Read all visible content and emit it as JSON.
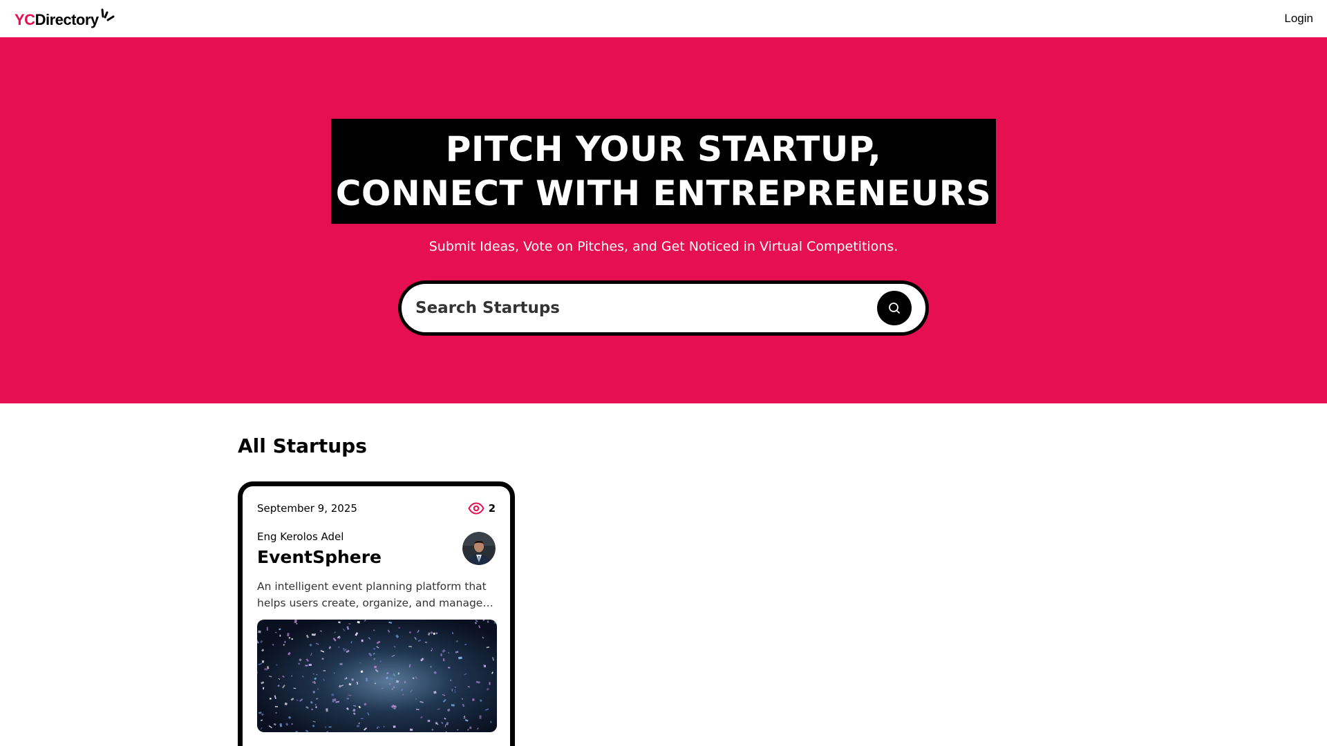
{
  "colors": {
    "brand_pink": "#e60f51",
    "black": "#000000",
    "white": "#ffffff"
  },
  "navbar": {
    "logo": {
      "prefix": "YC",
      "suffix": "Directory"
    },
    "login_label": "Login"
  },
  "hero": {
    "heading_line1": "PITCH YOUR STARTUP,",
    "heading_line2": "CONNECT WITH ENTREPRENEURS",
    "subtitle": "Submit Ideas, Vote on Pitches, and Get Noticed in Virtual Competitions.",
    "search": {
      "placeholder": "Search Startups",
      "button_icon": "search-icon"
    }
  },
  "main": {
    "section_title": "All Startups",
    "startups": [
      {
        "date": "September 9, 2025",
        "views": "2",
        "views_icon": "eye-icon",
        "author": "Eng Kerolos Adel",
        "title": "EventSphere",
        "description": "An intelligent event planning platform that helps users create, organize, and manage events with ease."
      }
    ]
  }
}
